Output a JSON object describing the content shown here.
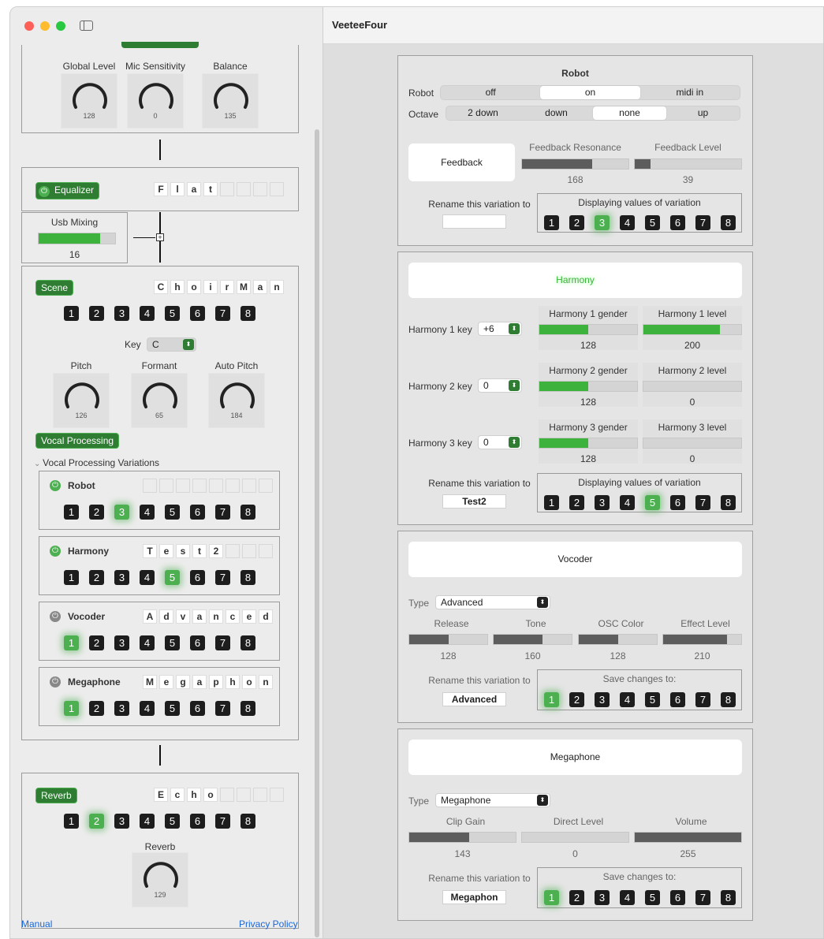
{
  "app_title": "VeeteeFour",
  "input": {
    "knobs": [
      {
        "label": "Global Level",
        "value": "128"
      },
      {
        "label": "Mic Sensitivity",
        "value": "0"
      },
      {
        "label": "Balance",
        "value": "135"
      }
    ]
  },
  "equalizer": {
    "label": "Equalizer",
    "letters": [
      "F",
      "l",
      "a",
      "t",
      "",
      "",
      "",
      ""
    ]
  },
  "usb": {
    "label": "Usb Mixing",
    "value": "16",
    "level": 0.8
  },
  "scene": {
    "label": "Scene",
    "letters": [
      "C",
      "h",
      "o",
      "i",
      "r",
      "M",
      "a",
      "n"
    ],
    "nums": [
      "1",
      "2",
      "3",
      "4",
      "5",
      "6",
      "7",
      "8"
    ],
    "key_label": "Key",
    "key_value": "C",
    "knobs": [
      {
        "label": "Pitch",
        "value": "126"
      },
      {
        "label": "Formant",
        "value": "65"
      },
      {
        "label": "Auto Pitch",
        "value": "184"
      }
    ]
  },
  "vocal": {
    "label": "Vocal Processing",
    "variations_label": "Vocal Processing Variations",
    "items": [
      {
        "name": "Robot",
        "letters": [
          "",
          "",
          "",
          "",
          "",
          "",
          "",
          ""
        ],
        "selected": 3,
        "power": "on"
      },
      {
        "name": "Harmony",
        "letters": [
          "T",
          "e",
          "s",
          "t",
          "2",
          "",
          "",
          ""
        ],
        "selected": 5,
        "power": "on"
      },
      {
        "name": "Vocoder",
        "letters": [
          "A",
          "d",
          "v",
          "a",
          "n",
          "c",
          "e",
          "d"
        ],
        "selected": 1,
        "power": "off"
      },
      {
        "name": "Megaphone",
        "letters": [
          "M",
          "e",
          "g",
          "a",
          "p",
          "h",
          "o",
          "n"
        ],
        "selected": 1,
        "power": "off"
      }
    ]
  },
  "reverb": {
    "label": "Reverb",
    "letters": [
      "E",
      "c",
      "h",
      "o",
      "",
      "",
      "",
      ""
    ],
    "selected": 2,
    "knob_label": "Reverb",
    "knob_value": "129"
  },
  "footer": {
    "manual": "Manual",
    "privacy": "Privacy Policy"
  },
  "robot": {
    "title": "Robot",
    "robot_label": "Robot",
    "robot_options": [
      "off",
      "on",
      "midi in"
    ],
    "robot_selected": 1,
    "octave_label": "Octave",
    "octave_options": [
      "2 down",
      "down",
      "none",
      "up"
    ],
    "octave_selected": 2,
    "feedback_button": "Feedback",
    "fb_res_label": "Feedback Resonance",
    "fb_res_value": "168",
    "fb_res_level": 0.66,
    "fb_level_label": "Feedback Level",
    "fb_level_value": "39",
    "fb_level_level": 0.15,
    "rename_label": "Rename this variation to",
    "rename_value": "",
    "display_label": "Displaying values of variation",
    "selected": 3
  },
  "harmony": {
    "title": "Harmony",
    "rows": [
      {
        "key_label": "Harmony 1 key",
        "key_value": "+6",
        "gender_label": "Harmony 1 gender",
        "gender_value": "128",
        "gender_level": 0.5,
        "level_label": "Harmony 1 level",
        "level_value": "200",
        "level_level": 0.78
      },
      {
        "key_label": "Harmony 2 key",
        "key_value": "0",
        "gender_label": "Harmony 2 gender",
        "gender_value": "128",
        "gender_level": 0.5,
        "level_label": "Harmony 2 level",
        "level_value": "0",
        "level_level": 0
      },
      {
        "key_label": "Harmony 3 key",
        "key_value": "0",
        "gender_label": "Harmony 3 gender",
        "gender_value": "128",
        "gender_level": 0.5,
        "level_label": "Harmony 3 level",
        "level_value": "0",
        "level_level": 0
      }
    ],
    "rename_label": "Rename this variation to",
    "rename_value": "Test2",
    "display_label": "Displaying values of variation",
    "selected": 5
  },
  "vocoder": {
    "title": "Vocoder",
    "type_label": "Type",
    "type_value": "Advanced",
    "params": [
      {
        "label": "Release",
        "value": "128",
        "level": 0.5
      },
      {
        "label": "Tone",
        "value": "160",
        "level": 0.63
      },
      {
        "label": "OSC Color",
        "value": "128",
        "level": 0.5
      },
      {
        "label": "Effect Level",
        "value": "210",
        "level": 0.82
      }
    ],
    "rename_label": "Rename this variation to",
    "rename_value": "Advanced",
    "save_label": "Save changes to:",
    "selected": 1
  },
  "megaphone": {
    "title": "Megaphone",
    "type_label": "Type",
    "type_value": "Megaphone",
    "params": [
      {
        "label": "Clip Gain",
        "value": "143",
        "level": 0.56
      },
      {
        "label": "Direct Level",
        "value": "0",
        "level": 0
      },
      {
        "label": "Volume",
        "value": "255",
        "level": 1
      }
    ],
    "rename_label": "Rename this variation to",
    "rename_value": "Megaphon",
    "save_label": "Save changes to:",
    "selected": 1
  },
  "nums": [
    "1",
    "2",
    "3",
    "4",
    "5",
    "6",
    "7",
    "8"
  ],
  "colors": {
    "accent_green": "#4caf50",
    "pill_green": "#2e7d32",
    "link_blue": "#1a66d9"
  }
}
